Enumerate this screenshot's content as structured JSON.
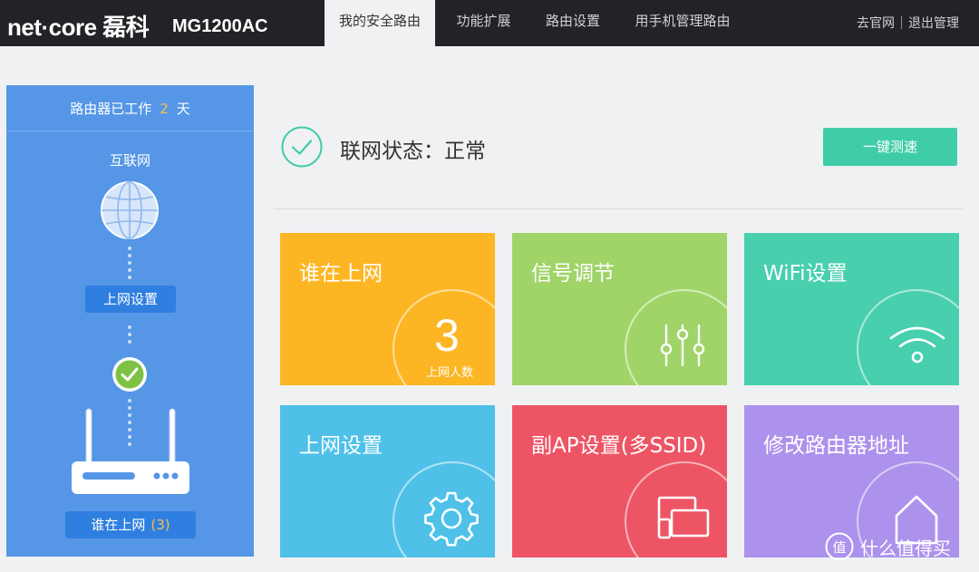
{
  "header": {
    "brand": "net·core 磊科",
    "model": "MG1200AC",
    "tabs": [
      {
        "label": "我的安全路由",
        "active": true
      },
      {
        "label": "功能扩展",
        "active": false
      },
      {
        "label": "路由设置",
        "active": false
      },
      {
        "label": "用手机管理路由",
        "active": false
      }
    ],
    "links": {
      "official": "去官网",
      "logout": "退出管理"
    }
  },
  "sidebar": {
    "uptime_prefix": "路由器已工作",
    "uptime_days": "2",
    "uptime_suffix": "天",
    "internet_label": "互联网",
    "wan_settings_button": "上网设置",
    "clients_label": "谁在上网",
    "clients_count": "(3)"
  },
  "status": {
    "text": "联网状态：正常",
    "speedtest_button": "一键测速"
  },
  "tiles": [
    {
      "title": "谁在上网",
      "count": "3",
      "count_label": "上网人数",
      "color": "#fdb623"
    },
    {
      "title": "信号调节",
      "color": "#a0d468"
    },
    {
      "title": "WiFi设置",
      "color": "#48cfad"
    },
    {
      "title": "上网设置",
      "color": "#4fc1e9"
    },
    {
      "title": "副AP设置(多SSID)",
      "color": "#ed5565"
    },
    {
      "title": "修改路由器地址",
      "color": "#ac92ec"
    }
  ],
  "watermark": {
    "icon": "smzdm-logo-icon",
    "text": "什么值得买"
  },
  "colors": {
    "accent_blue": "#5596e6",
    "button_green": "#3fcda7",
    "days_highlight": "#f5c14a"
  }
}
